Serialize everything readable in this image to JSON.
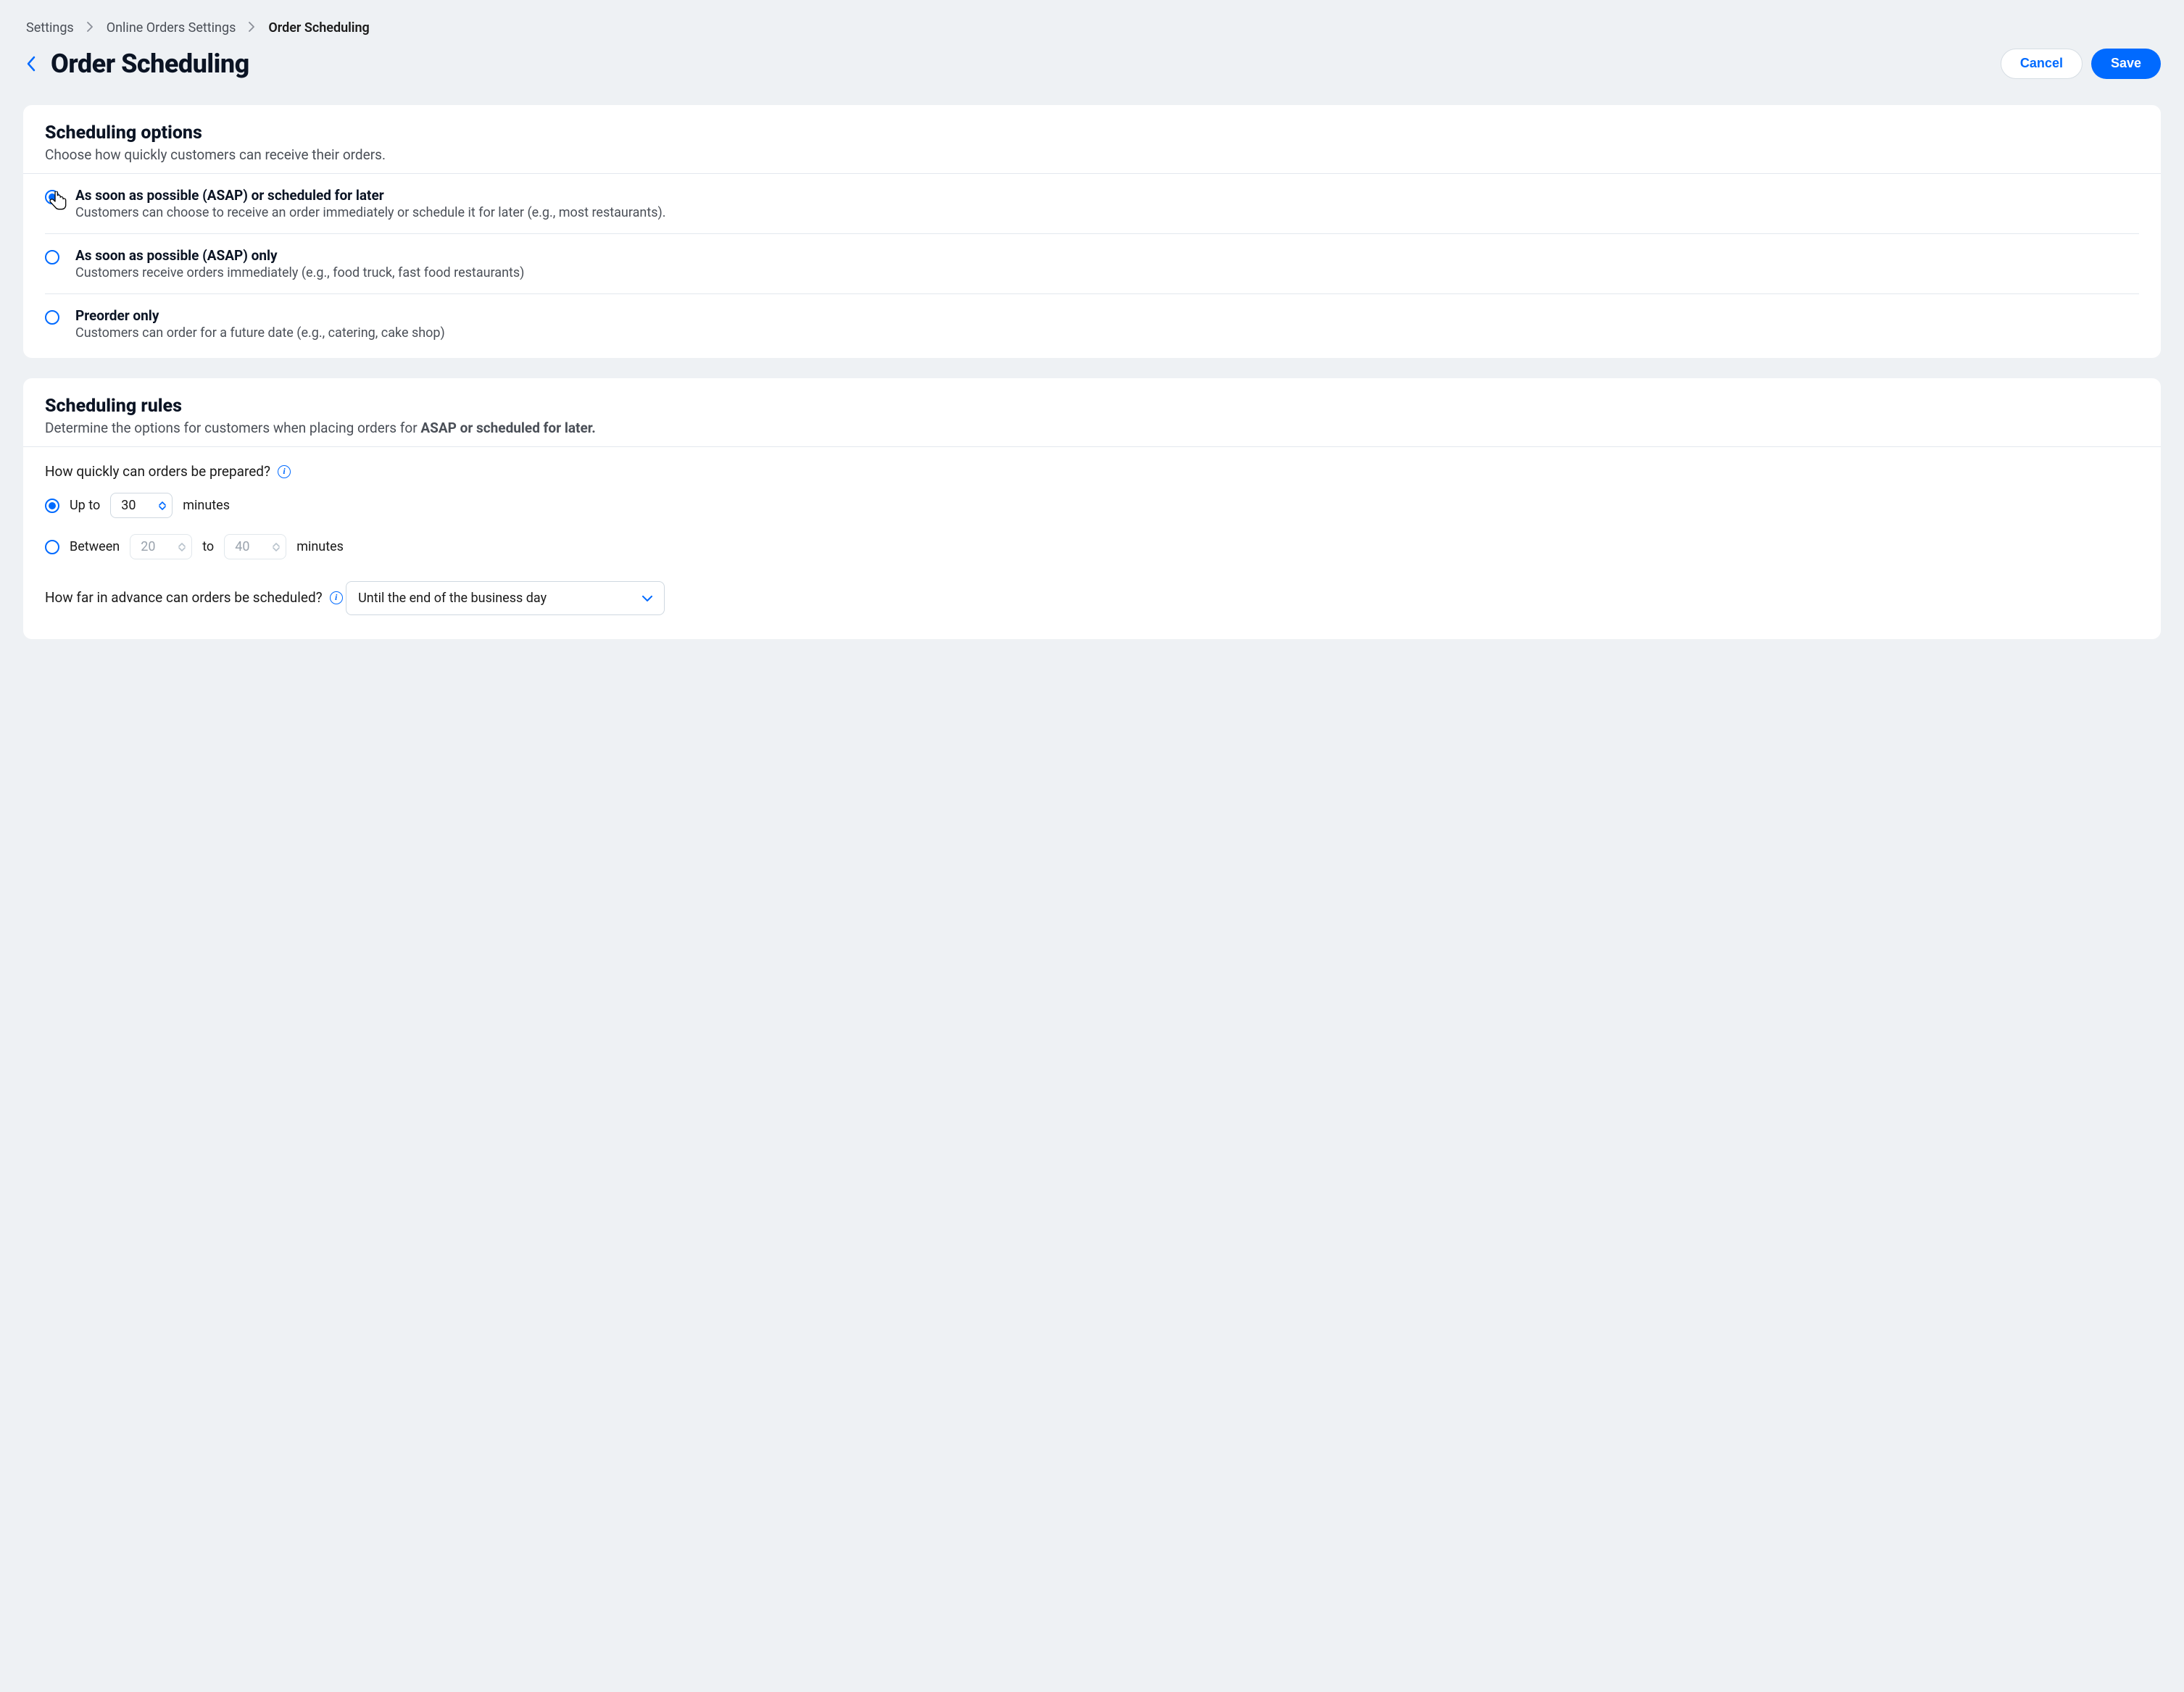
{
  "breadcrumb": {
    "items": [
      "Settings",
      "Online Orders Settings",
      "Order Scheduling"
    ]
  },
  "header": {
    "title": "Order Scheduling",
    "cancel": "Cancel",
    "save": "Save"
  },
  "options_card": {
    "title": "Scheduling options",
    "subtitle": "Choose how quickly customers can receive their orders.",
    "options": [
      {
        "title": "As soon as possible (ASAP) or scheduled for later",
        "desc": "Customers can choose to receive an order immediately or schedule it for later (e.g., most restaurants).",
        "selected": true
      },
      {
        "title": "As soon as possible (ASAP)  only",
        "desc": "Customers receive orders immediately (e.g., food truck, fast food restaurants)",
        "selected": false
      },
      {
        "title": "Preorder only",
        "desc": "Customers can order for a future date (e.g., catering, cake shop)",
        "selected": false
      }
    ]
  },
  "rules_card": {
    "title": "Scheduling rules",
    "subtitle_prefix": "Determine the options for customers when placing orders for ",
    "subtitle_bold": "ASAP or scheduled for later.",
    "prep_question": "How quickly can orders be prepared?",
    "upto_label": "Up to",
    "upto_value": "30",
    "minutes": "minutes",
    "between_label": "Between",
    "between_min": "20",
    "to_label": "to",
    "between_max": "40",
    "advance_question": "How far in advance can orders be scheduled?",
    "advance_value": "Until the end of the business day"
  }
}
